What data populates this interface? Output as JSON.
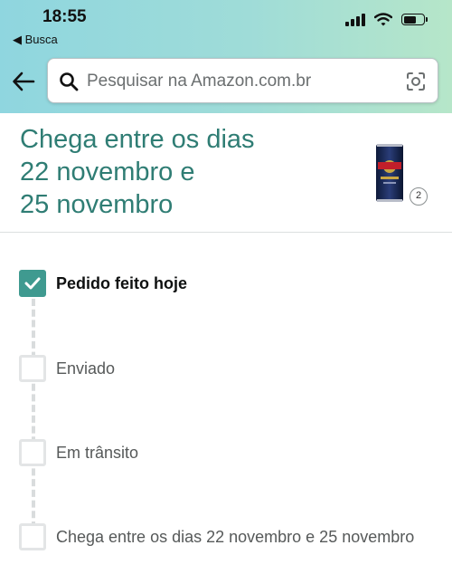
{
  "status_bar": {
    "time": "18:55",
    "back_app_label": "◀ Busca"
  },
  "search": {
    "placeholder": "Pesquisar na Amazon.com.br"
  },
  "delivery": {
    "headline_line1": "Chega entre os dias",
    "headline_line2": "22 novembro e",
    "headline_line3": "25 novembro",
    "item_quantity": "2"
  },
  "timeline": {
    "steps": [
      {
        "label": "Pedido feito hoje",
        "completed": true
      },
      {
        "label": "Enviado",
        "completed": false
      },
      {
        "label": "Em trânsito",
        "completed": false
      },
      {
        "label": "Chega entre os dias 22 novembro e 25 novembro",
        "completed": false
      }
    ]
  },
  "colors": {
    "accent": "#2f7d74",
    "checkbox_done": "#3f9a90",
    "header_gradient_start": "#8fd6df",
    "header_gradient_end": "#b6e6c9"
  }
}
